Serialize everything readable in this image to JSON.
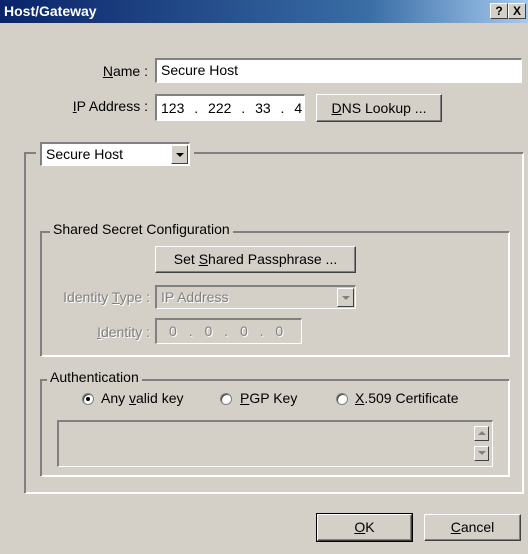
{
  "window": {
    "title": "Host/Gateway",
    "help_glyph": "?",
    "close_glyph": "X"
  },
  "host": {
    "name_label": "Name :",
    "name_accel": "N",
    "name_value": "Secure Host",
    "ip_label": "IP Address :",
    "ip_accel": "I",
    "ip_octets": [
      "123",
      "222",
      "33",
      "4"
    ],
    "dns_button": "DNS Lookup ...",
    "dns_accel": "D"
  },
  "host_type_combo": {
    "selected": "Secure Host"
  },
  "shared_secret": {
    "group_title": "Shared Secret Configuration",
    "set_passphrase_button": "Set Shared Passphrase ...",
    "passphrase_accel": "S",
    "identity_type_label": "Identity Type :",
    "identity_type_accel": "T",
    "identity_type_value": "IP Address",
    "identity_label": "Identity :",
    "identity_accel": "I",
    "identity_octets": [
      "0",
      "0",
      "0",
      "0"
    ]
  },
  "authentication": {
    "group_title": "Authentication",
    "options": [
      {
        "label": "Any valid key",
        "accel": "v",
        "checked": true
      },
      {
        "label": "PGP Key",
        "accel": "P",
        "checked": false
      },
      {
        "label": "X.509 Certificate",
        "accel": "X",
        "checked": false
      }
    ]
  },
  "buttons": {
    "ok": "OK",
    "ok_accel": "O",
    "cancel": "Cancel",
    "cancel_accel": "C"
  },
  "icons": {
    "help": "help-question-icon",
    "close": "close-icon",
    "dropdown": "chevron-down-icon",
    "scroll_up": "scroll-up-arrow-icon",
    "scroll_down": "scroll-down-arrow-icon"
  },
  "colors": {
    "title_bar": "#0a246a",
    "dialog_face": "#d4d0c8",
    "disabled_text": "#808080"
  }
}
